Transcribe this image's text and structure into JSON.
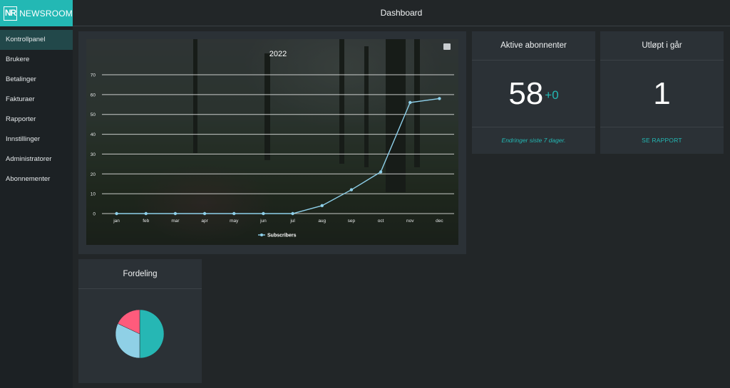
{
  "app": {
    "logo_mark": "NR",
    "logo_text": "NEWSROOM",
    "page_title": "Dashboard"
  },
  "sidebar": {
    "items": [
      {
        "label": "Kontrollpanel",
        "active": true
      },
      {
        "label": "Brukere"
      },
      {
        "label": "Betalinger"
      },
      {
        "label": "Fakturaer"
      },
      {
        "label": "Rapporter"
      },
      {
        "label": "Innstillinger"
      },
      {
        "label": "Administratorer"
      },
      {
        "label": "Abonnementer"
      }
    ]
  },
  "cards": {
    "active_subscribers": {
      "title": "Aktive abonnenter",
      "value": "58",
      "delta": "+0",
      "footer": "Endringer siste 7 dager."
    },
    "expired_yesterday": {
      "title": "Utløpt i går",
      "value": "1",
      "footer": "SE RAPPORT"
    },
    "distribution": {
      "title": "Fordeling"
    }
  },
  "icons": {
    "chart_image": "image-icon"
  },
  "colors": {
    "accent": "#23b8b4",
    "line": "#8ed0ea",
    "pie_teal": "#26b7b4",
    "pie_blue": "#8fd0e6",
    "pie_pink": "#ff5b7c"
  },
  "chart_data": [
    {
      "type": "line",
      "title": "2022",
      "categories": [
        "jan",
        "feb",
        "mar",
        "apr",
        "may",
        "jun",
        "jul",
        "aug",
        "sep",
        "oct",
        "nov",
        "dec"
      ],
      "series": [
        {
          "name": "Subscribers",
          "values": [
            0,
            0,
            0,
            0,
            0,
            0,
            0,
            4,
            12,
            21,
            56,
            58
          ]
        }
      ],
      "ylim": [
        0,
        70
      ],
      "yticks": [
        0,
        10,
        20,
        30,
        40,
        50,
        60,
        70
      ],
      "grid": true,
      "legend": "bottom"
    },
    {
      "type": "pie",
      "title": "Fordeling",
      "values": [
        0.5,
        0.32,
        0.18
      ],
      "colors": [
        "#26b7b4",
        "#8fd0e6",
        "#ff5b7c"
      ]
    }
  ]
}
